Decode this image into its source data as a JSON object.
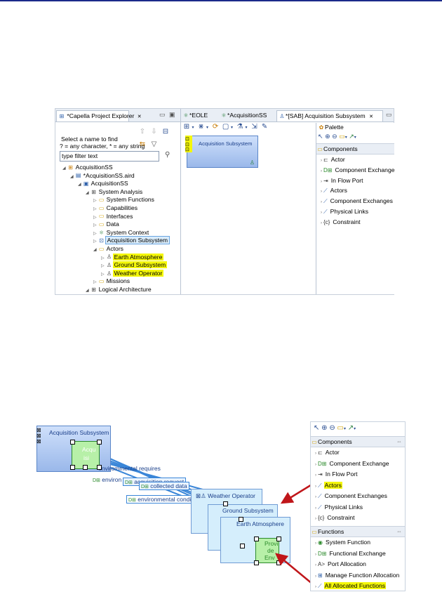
{
  "top": {
    "explorer": {
      "title": "*Capella Project Explorer",
      "close": "✕",
      "search_hint_1": "Select a name to find",
      "search_hint_2": "? = any character, * = any string",
      "filter_value": "type filter text",
      "tree": [
        {
          "label": "AcquisitionSS",
          "level": 0,
          "icon": "project-icon",
          "highlight": false
        },
        {
          "label": "*AcquisitionSS.aird",
          "level": 1,
          "icon": "aird-file-icon",
          "highlight": false
        },
        {
          "label": "AcquisitionSS",
          "level": 2,
          "icon": "model-icon",
          "highlight": false
        },
        {
          "label": "System Analysis",
          "level": 3,
          "icon": "package-icon",
          "highlight": false
        },
        {
          "label": "System Functions",
          "level": 4,
          "icon": "folder-icon",
          "highlight": false
        },
        {
          "label": "Capabilities",
          "level": 4,
          "icon": "folder-icon",
          "highlight": false
        },
        {
          "label": "Interfaces",
          "level": 4,
          "icon": "folder-icon",
          "highlight": false
        },
        {
          "label": "Data",
          "level": 4,
          "icon": "folder-icon",
          "highlight": false
        },
        {
          "label": "System Context",
          "level": 4,
          "icon": "context-icon",
          "highlight": false
        },
        {
          "label": "Acquisition Subsystem",
          "level": 4,
          "icon": "component-icon",
          "highlight": false,
          "selected": true
        },
        {
          "label": "Actors",
          "level": 4,
          "icon": "folder-icon",
          "highlight": false
        },
        {
          "label": "Earth Atmosphere",
          "level": 5,
          "icon": "actor-icon",
          "highlight": true
        },
        {
          "label": "Ground Subsystem",
          "level": 5,
          "icon": "actor-icon",
          "highlight": true
        },
        {
          "label": "Weather Operator",
          "level": 5,
          "icon": "actor-icon",
          "highlight": true
        },
        {
          "label": "Missions",
          "level": 4,
          "icon": "folder-icon",
          "highlight": false
        },
        {
          "label": "Logical Architecture",
          "level": 3,
          "icon": "package-icon",
          "highlight": false
        }
      ]
    },
    "editor": {
      "tabs": [
        "*EOLE",
        "*AcquisitionSS",
        "*[SAB] Acquisition Subsystem"
      ],
      "tab_close": "✕",
      "node_label": "Acquisition Subsystem"
    },
    "palette": {
      "title": "Palette",
      "section": "Components",
      "items": [
        "Actor",
        "Component Exchange",
        "In Flow Port",
        "Actors",
        "Component Exchanges",
        "Physical Links",
        "Constraint"
      ]
    }
  },
  "bottom": {
    "diagram": {
      "main_node": "Acquisition Subsystem",
      "func_frag_1": "Acqu",
      "func_frag_2": "isi",
      "exchanges": [
        "envirommental requires",
        "environ",
        "acquisition request",
        "collected data",
        "environmental conditions"
      ],
      "actors": [
        "Weather Operator",
        "Ground Subsystem",
        "Earth Atmosphere"
      ],
      "provide_frag": [
        "Provi",
        "de",
        "Env"
      ]
    },
    "palette": {
      "sec_components": "Components",
      "components": [
        "Actor",
        "Component Exchange",
        "In Flow Port",
        "Actors",
        "Component Exchanges",
        "Physical Links",
        "Constraint"
      ],
      "sec_functions": "Functions",
      "functions": [
        "System Function",
        "Functional Exchange",
        "Port Allocation",
        "Manage Function Allocation",
        "All Allocated Functions"
      ]
    },
    "colors": {
      "highlight": "#f4f70b",
      "arrow": "#c0161a",
      "exchange": "#3a86d8"
    }
  }
}
